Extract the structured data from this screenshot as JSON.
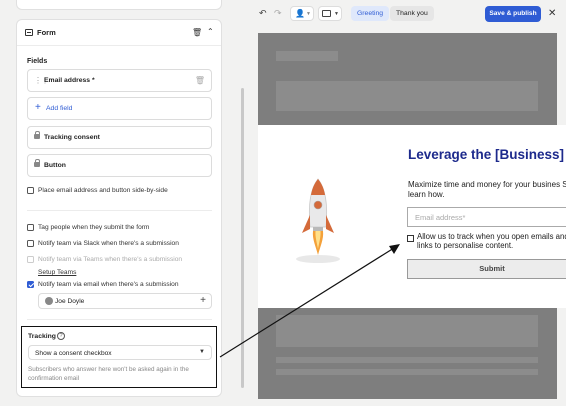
{
  "form_card": {
    "title": "Form",
    "fields_heading": "Fields",
    "fields": [
      {
        "label": "Email address *"
      },
      {
        "label": "Tracking consent"
      },
      {
        "label": "Button"
      }
    ],
    "add_field_label": "Add field",
    "side_by_side_label": "Place email address and button side-by-side",
    "options": {
      "tag_people": "Tag people when they submit the form",
      "notify_slack": "Notify team via Slack when there's a submission",
      "notify_teams": "Notify team via Teams when there's a submission",
      "setup_teams": "Setup Teams",
      "notify_email": "Notify team via email when there's a submission"
    },
    "person": "Joe Doyle"
  },
  "tracking": {
    "label": "Tracking",
    "select_value": "Show a consent checkbox",
    "note": "Subscribers who answer here won't be asked again in the confirmation email"
  },
  "toolbar": {
    "tab_greeting": "Greeting",
    "tab_thank_you": "Thank you",
    "save_label": "Save & publish"
  },
  "preview": {
    "heading": "Leverage the [Business] edge",
    "subtext": "Maximize time and money for your busines Sign up to learn how.",
    "email_placeholder": "Email address*",
    "consent_text": "Allow us to track when you open emails and click links to personalise content.",
    "submit_label": "Submit"
  },
  "colors": {
    "accent": "#2f5cd4",
    "heading": "#1d2a8c",
    "overlay": "#7e7e7e"
  }
}
